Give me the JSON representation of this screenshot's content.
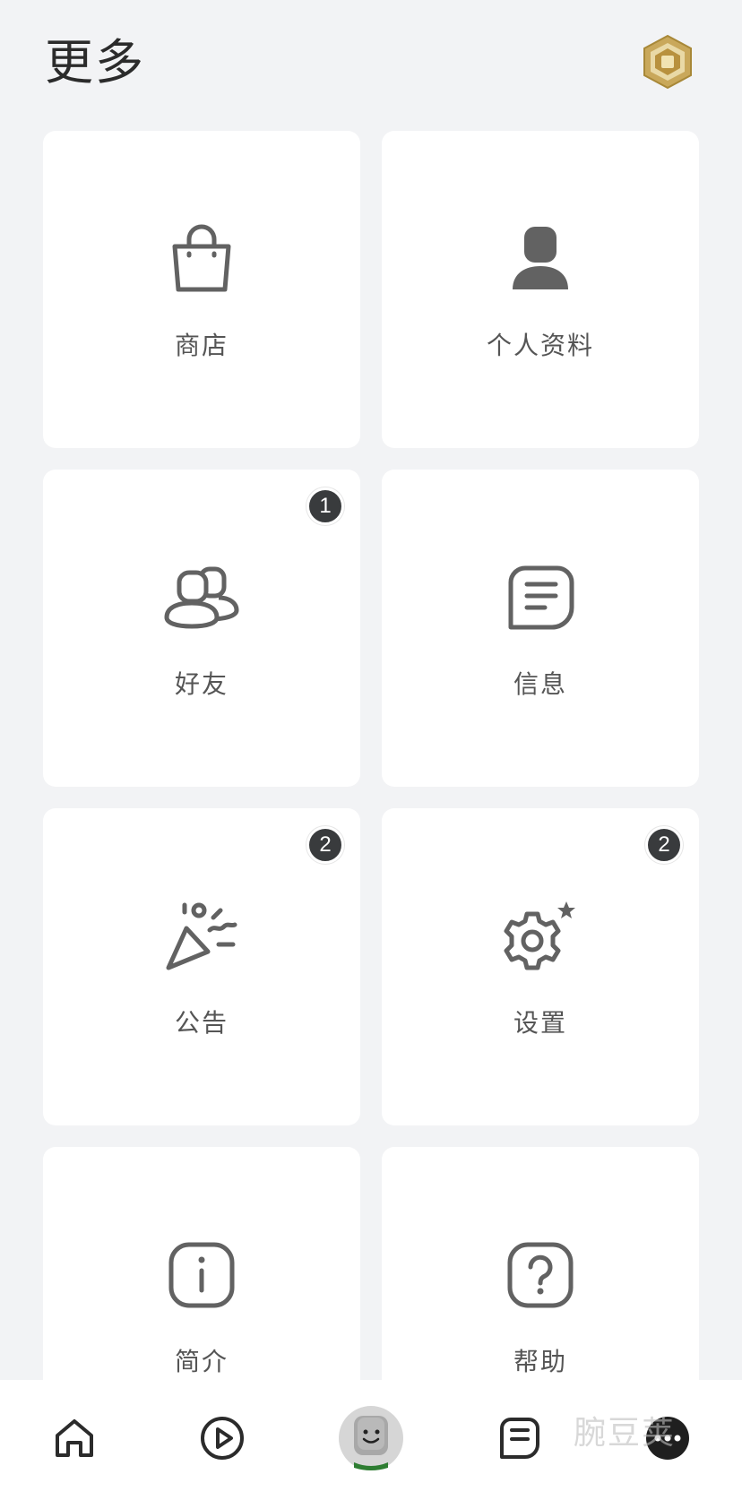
{
  "header": {
    "title": "更多",
    "robux_icon": "robux-icon"
  },
  "tiles": [
    {
      "label": "商店",
      "icon": "shopping-bag-icon",
      "badge": ""
    },
    {
      "label": "个人资料",
      "icon": "profile-icon",
      "badge": ""
    },
    {
      "label": "好友",
      "icon": "friends-icon",
      "badge": "1"
    },
    {
      "label": "信息",
      "icon": "message-icon",
      "badge": ""
    },
    {
      "label": "公告",
      "icon": "party-popper-icon",
      "badge": "2"
    },
    {
      "label": "设置",
      "icon": "gear-icon",
      "badge": "2"
    },
    {
      "label": "简介",
      "icon": "info-icon",
      "badge": ""
    },
    {
      "label": "帮助",
      "icon": "help-icon",
      "badge": ""
    }
  ],
  "tab_bar": {
    "items": [
      "home-icon",
      "play-icon",
      "avatar-icon",
      "chat-icon",
      "more-icon"
    ]
  },
  "watermark": "腕豆荚",
  "colors": {
    "background": "#f2f3f5",
    "card": "#ffffff",
    "icon": "#626262",
    "badge": "#393b3d",
    "robux_gold": "#c8a85a"
  }
}
